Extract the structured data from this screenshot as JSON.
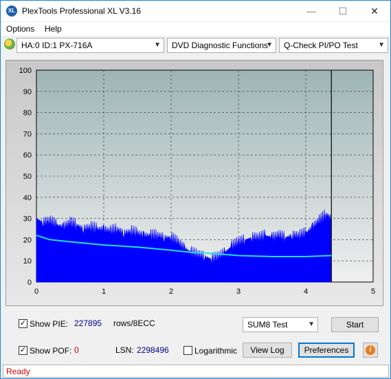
{
  "window": {
    "title": "PlexTools Professional XL V3.16",
    "icon_label": "XL",
    "controls": {
      "minimize": "—",
      "maximize": "☐",
      "close": "✕"
    }
  },
  "menu": {
    "items": [
      "Options",
      "Help"
    ]
  },
  "toolbar": {
    "drive": "HA:0 ID:1  PX-716A",
    "function": "DVD Diagnostic Functions",
    "test": "Q-Check PI/PO Test"
  },
  "chart_data": {
    "type": "area",
    "xlim": [
      0,
      5
    ],
    "ylim": [
      0,
      100
    ],
    "x_ticks": [
      "0",
      "1",
      "2",
      "3",
      "4",
      "5"
    ],
    "y_ticks": [
      "0",
      "10",
      "20",
      "30",
      "40",
      "50",
      "60",
      "70",
      "80",
      "90",
      "100"
    ],
    "grid": true,
    "data_end_x": 4.38,
    "colors": {
      "pie": "#0000ff",
      "average": "#20e0e0",
      "plot_bg_top": "#9eb4b4",
      "plot_bg_bottom": "#f0f0f0"
    },
    "series": [
      {
        "values_x": [
          0,
          0.1,
          0.2,
          0.3,
          0.4,
          0.5,
          0.6,
          0.7,
          0.8,
          0.9,
          1.0,
          1.1,
          1.2,
          1.3,
          1.4,
          1.5,
          1.6,
          1.7,
          1.8,
          1.9,
          2.0,
          2.1,
          2.2,
          2.3,
          2.4,
          2.5,
          2.6,
          2.7,
          2.8,
          2.9,
          3.0,
          3.1,
          3.2,
          3.3,
          3.4,
          3.5,
          3.6,
          3.7,
          3.8,
          3.9,
          4.0,
          4.1,
          4.2,
          4.3,
          4.38
        ],
        "values_y": [
          33,
          31,
          32,
          30,
          29,
          31,
          30,
          28,
          29,
          28,
          28,
          27,
          28,
          26,
          27,
          26,
          25,
          25,
          25,
          24,
          24,
          22,
          19,
          17,
          16,
          15,
          14,
          15,
          17,
          20,
          22,
          23,
          24,
          24,
          25,
          24,
          25,
          24,
          25,
          25,
          26,
          29,
          32,
          35,
          33
        ]
      },
      {
        "values_x": [
          0,
          0.2,
          0.5,
          1.0,
          1.5,
          2.0,
          2.3,
          2.6,
          2.8,
          3.0,
          3.5,
          4.0,
          4.38
        ],
        "values_y": [
          22,
          20,
          19,
          17.5,
          16.5,
          15,
          14,
          13.5,
          13,
          12.5,
          12,
          12,
          12.5
        ]
      }
    ]
  },
  "controls": {
    "show_pie_label": "Show PIE:",
    "pie_value": "227895",
    "pie_unit": "rows/8ECC",
    "show_pof_label": "Show POF:",
    "pof_value": "0",
    "lsn_label": "LSN:",
    "lsn_value": "2298496",
    "logarithmic_label": "Logarithmic",
    "sum_select": "SUM8 Test",
    "start_label": "Start",
    "view_log_label": "View Log",
    "preferences_label": "Preferences",
    "info_icon": "i",
    "check_mark": "✓"
  },
  "status": {
    "text": "Ready"
  }
}
